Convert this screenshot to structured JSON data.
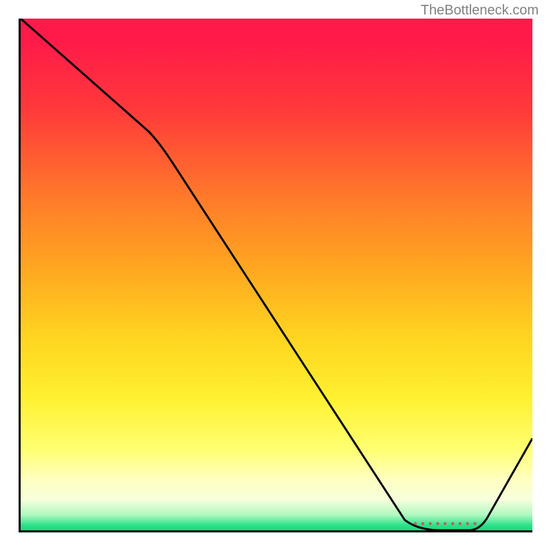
{
  "watermark": "TheBottleneck.com",
  "annotation_text": "● ● ● ● ● ● ● ● ●",
  "chart_data": {
    "type": "line",
    "title": "",
    "xlabel": "",
    "ylabel": "",
    "xlim": [
      0,
      100
    ],
    "ylim": [
      0,
      100
    ],
    "grid": false,
    "legend": false,
    "description": "Bottleneck percentage over performance axis with vertical heat gradient (red high, green low)",
    "series": [
      {
        "name": "bottleneck-curve",
        "x": [
          0,
          25,
          75,
          82,
          88,
          100
        ],
        "values": [
          100,
          78,
          2,
          0,
          0,
          18
        ]
      }
    ],
    "annotations": [
      {
        "x": 84,
        "y": 0,
        "label": "optimal-zone"
      }
    ],
    "gradient_stops": [
      {
        "pct": 0,
        "color": "#ff1a4a"
      },
      {
        "pct": 50,
        "color": "#ffd420"
      },
      {
        "pct": 85,
        "color": "#ffff70"
      },
      {
        "pct": 100,
        "color": "#1ad67c"
      }
    ]
  }
}
